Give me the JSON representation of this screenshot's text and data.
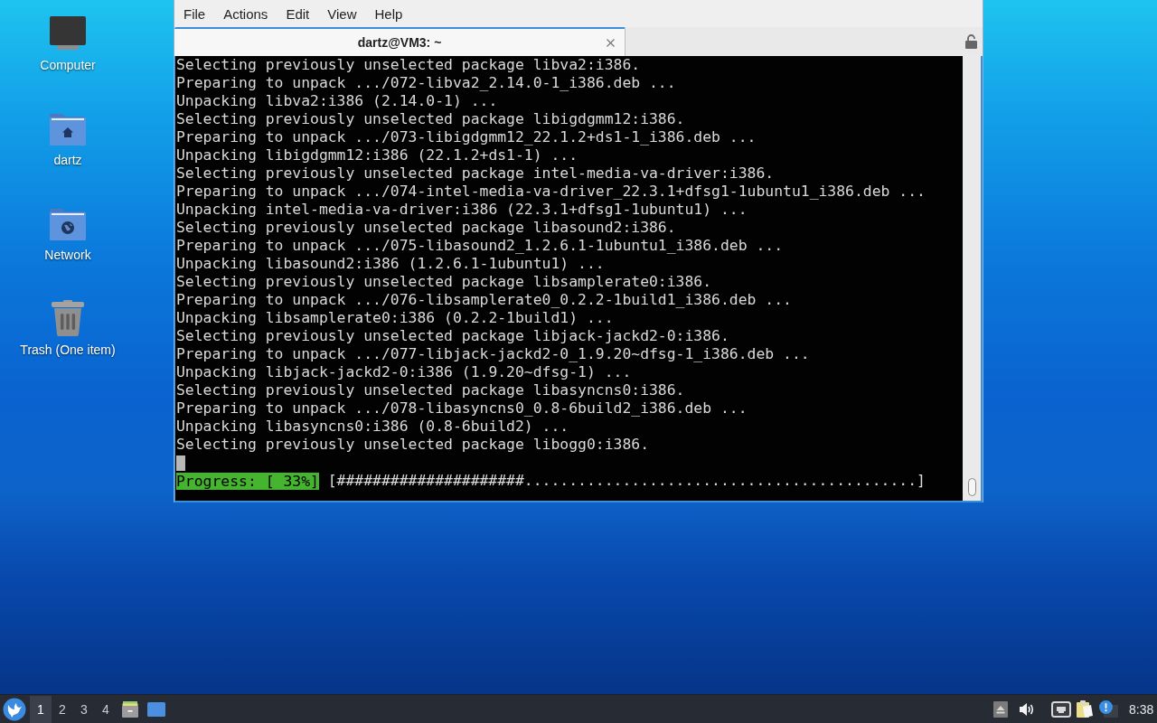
{
  "desktop": {
    "icons": [
      {
        "kind": "computer",
        "label": "Computer"
      },
      {
        "kind": "home",
        "label": "dartz"
      },
      {
        "kind": "network",
        "label": "Network"
      },
      {
        "kind": "trash",
        "label": "Trash (One item)"
      }
    ]
  },
  "terminal": {
    "menu": [
      "File",
      "Actions",
      "Edit",
      "View",
      "Help"
    ],
    "tabs": [
      {
        "title": "dartz@VM3: ~",
        "selected": true
      }
    ],
    "lines": [
      "Selecting previously unselected package libva2:i386.",
      "Preparing to unpack .../072-libva2_2.14.0-1_i386.deb ...",
      "Unpacking libva2:i386 (2.14.0-1) ...",
      "Selecting previously unselected package libigdgmm12:i386.",
      "Preparing to unpack .../073-libigdgmm12_22.1.2+ds1-1_i386.deb ...",
      "Unpacking libigdgmm12:i386 (22.1.2+ds1-1) ...",
      "Selecting previously unselected package intel-media-va-driver:i386.",
      "Preparing to unpack .../074-intel-media-va-driver_22.3.1+dfsg1-1ubuntu1_i386.deb ...",
      "Unpacking intel-media-va-driver:i386 (22.3.1+dfsg1-1ubuntu1) ...",
      "Selecting previously unselected package libasound2:i386.",
      "Preparing to unpack .../075-libasound2_1.2.6.1-1ubuntu1_i386.deb ...",
      "Unpacking libasound2:i386 (1.2.6.1-1ubuntu1) ...",
      "Selecting previously unselected package libsamplerate0:i386.",
      "Preparing to unpack .../076-libsamplerate0_0.2.2-1build1_i386.deb ...",
      "Unpacking libsamplerate0:i386 (0.2.2-1build1) ...",
      "Selecting previously unselected package libjack-jackd2-0:i386.",
      "Preparing to unpack .../077-libjack-jackd2-0_1.9.20~dfsg-1_i386.deb ...",
      "Unpacking libjack-jackd2-0:i386 (1.9.20~dfsg-1) ...",
      "Selecting previously unselected package libasyncns0:i386.",
      "Preparing to unpack .../078-libasyncns0_0.8-6build2_i386.deb ...",
      "Unpacking libasyncns0:i386 (0.8-6build2) ...",
      "Selecting previously unselected package libogg0:i386."
    ],
    "progress": {
      "label": "Progress: [ 33%]",
      "bar": "[#####################............................................]"
    }
  },
  "taskbar": {
    "workspaces": [
      {
        "label": "1",
        "selected": true
      },
      {
        "label": "2",
        "selected": false
      },
      {
        "label": "3",
        "selected": false
      },
      {
        "label": "4",
        "selected": false
      }
    ],
    "clock": "8:38"
  }
}
